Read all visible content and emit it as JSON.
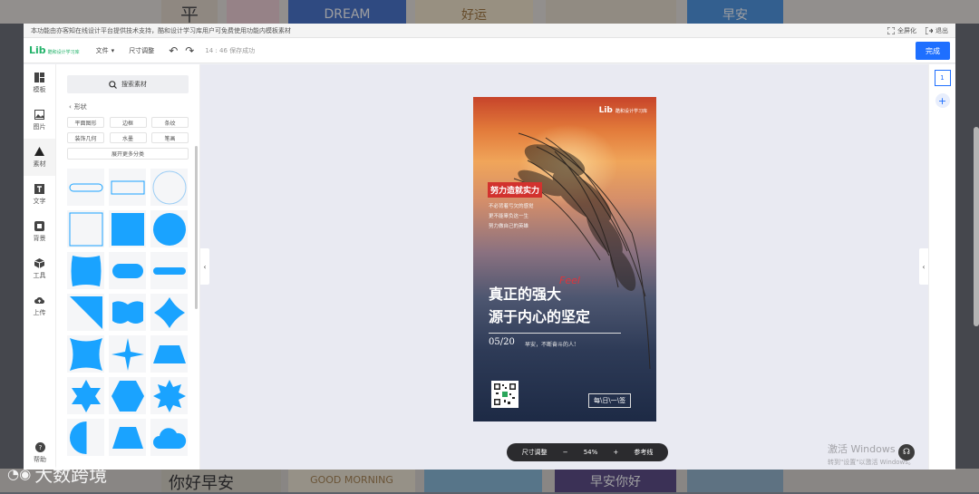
{
  "notice": {
    "text": "本功能由亦客知在线设计平台提供技术支持，酷和设计学习库用户可免费使用功能内模板素材",
    "fullscreen_label": "全屏化",
    "exit_label": "退出"
  },
  "topbar": {
    "brand": "Lib",
    "brand_sub": "酷和设计学习库",
    "file_menu": "文件",
    "resize_label": "尺寸调整",
    "save_status": "14 : 46 保存成功",
    "done_label": "完成"
  },
  "leftnav": {
    "items": [
      {
        "label": "模板",
        "icon": "template-icon"
      },
      {
        "label": "图片",
        "icon": "image-icon"
      },
      {
        "label": "素材",
        "icon": "material-icon"
      },
      {
        "label": "文字",
        "icon": "text-icon"
      },
      {
        "label": "背景",
        "icon": "background-icon"
      },
      {
        "label": "工具",
        "icon": "tools-icon"
      },
      {
        "label": "上传",
        "icon": "upload-icon"
      }
    ],
    "help_label": "帮助"
  },
  "panel": {
    "search_label": "搜索素材",
    "breadcrumb": "形状",
    "tags": [
      "平面图形",
      "边框",
      "条纹",
      "装饰几何",
      "水墨",
      "笔画"
    ],
    "expand_label": "展开更多分类",
    "shape_color": "#1aa3ff"
  },
  "poster": {
    "brand": "Lib",
    "brand_sub": "酷和设计学习库",
    "tagline": "努力造就实力",
    "lines": [
      "不必背着亏欠的感觉",
      "更不能辜负这一生",
      "努力做自己的英雄"
    ],
    "scribble": "Feel",
    "headline1": "真正的强大",
    "headline2": "源于内心的坚定",
    "date": "05/20",
    "greeting": "早安，不断奋斗的人!",
    "daily": "每\\日\\一\\签"
  },
  "zoom": {
    "resize_label": "尺寸调整",
    "minus": "−",
    "value": "54%",
    "plus": "+",
    "guide_label": "参考线"
  },
  "activation": {
    "title": "激活 Windows",
    "subtitle": "转到\"设置\"以激活 Windows。"
  },
  "rightnav": {
    "page_number": "1",
    "add_label": "+"
  },
  "watermark": {
    "text": "大数跨境"
  },
  "background_thumbs_top": [
    "平",
    "DREAM",
    "好运",
    "早安"
  ],
  "background_thumbs_bottom": [
    "你好早安",
    "GOOD MORNING",
    "早安你好"
  ]
}
